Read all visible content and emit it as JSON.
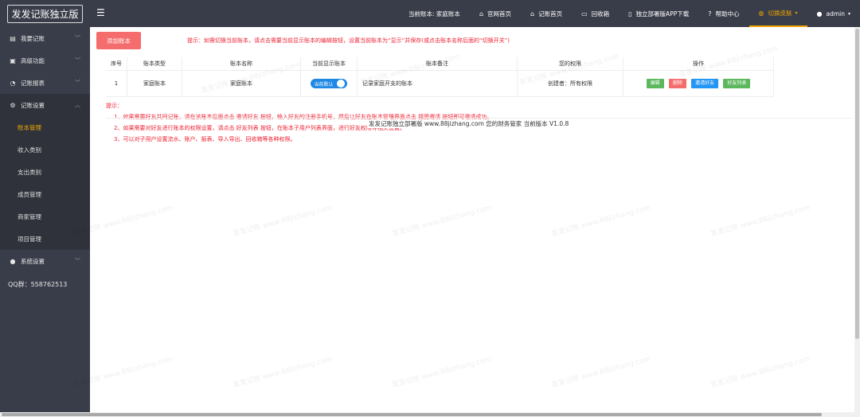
{
  "sidebar": {
    "logo": "发发记账独立版",
    "menu": [
      {
        "label": "我要记账",
        "icon": "document-icon"
      },
      {
        "label": "高级功能",
        "icon": "briefcase-icon"
      },
      {
        "label": "记账报表",
        "icon": "pie-chart-icon"
      },
      {
        "label": "记账设置",
        "icon": "gear-icon"
      }
    ],
    "submenu": [
      "账本管理",
      "收入类别",
      "支出类别",
      "成员管理",
      "商家管理",
      "项目管理"
    ],
    "system": {
      "label": "系统设置",
      "icon": "user-icon"
    },
    "qq": "QQ群：558762513"
  },
  "header": {
    "current_book": "当前账本: 家庭账本",
    "nav": [
      {
        "label": "官网首页",
        "icon": "home-icon"
      },
      {
        "label": "记账首页",
        "icon": "home-icon"
      },
      {
        "label": "回收箱",
        "icon": "trash-icon"
      },
      {
        "label": "独立部署版APP下载",
        "icon": "phone-icon"
      },
      {
        "label": "帮助中心",
        "icon": "help-icon"
      },
      {
        "label": "切换皮肤",
        "icon": "palette-icon"
      },
      {
        "label": "admin",
        "icon": "user-icon"
      }
    ]
  },
  "main": {
    "add_button": "添加账本",
    "tip_top": "提示：如需切换当前账本，请点击需要当前显示账本的编辑按钮，设置当前账本为“显示”并保存(或点击账本名称后面的“切换开关”)",
    "table": {
      "headers": [
        "序号",
        "账本类型",
        "账本名称",
        "当前显示账本",
        "账本备注",
        "您的权限",
        "操作"
      ],
      "rows": [
        {
          "index": "1",
          "type": "家庭账本",
          "name": "家庭账本",
          "toggle": "当前默认",
          "note": "记录家庭开支的账本",
          "perm": "创建者：所有权限",
          "ops": [
            "编辑",
            "删除",
            "邀请好友",
            "好友列表"
          ]
        }
      ]
    },
    "tips": {
      "title": "提示：",
      "lines": [
        "1、如果需要好友共同记账，请在该账本后面点击 邀请好友 按钮，输入好友的注册手机号，然后让好友在账本管理界面点击 接受邀请 按钮即可邀请成功。",
        "2、如果需要对好友进行账本的权限设置，请点击 好友列表 按钮，在账本子用户列表界面，进行好友权限等相关设置。",
        "3、可以对子用户设置流水、账户、报表、导入导出、回收箱等各种权限。"
      ]
    },
    "footer": "发发记账独立部署版    www.88jizhang.com    您的财务管家  当前版本 V1.0.8"
  },
  "watermark": "发发记账 www.88jizhang.com"
}
